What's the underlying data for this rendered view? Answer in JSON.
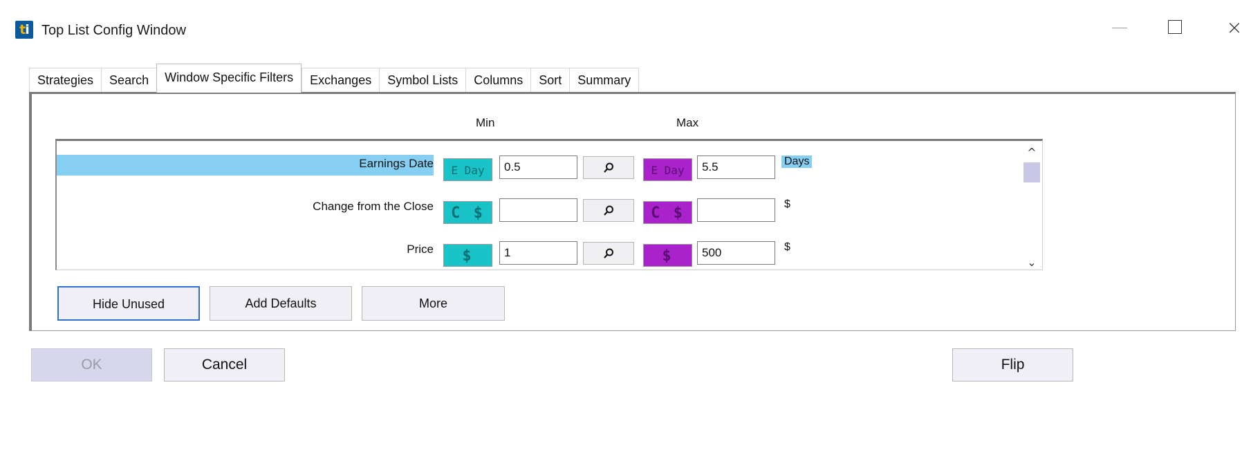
{
  "window": {
    "title": "Top List Config Window",
    "icon_letters": [
      "t",
      "i"
    ],
    "close_glyph": "×"
  },
  "tabs": [
    {
      "label": "Strategies",
      "active": false
    },
    {
      "label": "Search",
      "active": false
    },
    {
      "label": "Window Specific Filters",
      "active": true
    },
    {
      "label": "Exchanges",
      "active": false
    },
    {
      "label": "Symbol Lists",
      "active": false
    },
    {
      "label": "Columns",
      "active": false
    },
    {
      "label": "Sort",
      "active": false
    },
    {
      "label": "Summary",
      "active": false
    }
  ],
  "columns": {
    "min": "Min",
    "max": "Max"
  },
  "filters": [
    {
      "label": "Earnings Date",
      "min_badge": "E Day",
      "min_value": "0.5",
      "max_badge": "E Day",
      "max_value": "5.5",
      "unit": "Days",
      "selected": true
    },
    {
      "label": "Change from the Close",
      "min_badge": "C $",
      "min_value": "",
      "max_badge": "C $",
      "max_value": "",
      "unit": "$",
      "selected": false
    },
    {
      "label": "Price",
      "min_badge": "$",
      "min_value": "1",
      "max_badge": "$",
      "max_value": "500",
      "unit": "$",
      "selected": false
    }
  ],
  "scrollbar": {
    "up_glyph": "^",
    "down_glyph": "⌄"
  },
  "panel_buttons": {
    "hide_unused": "Hide Unused",
    "add_defaults": "Add Defaults",
    "more": "More"
  },
  "footer_buttons": {
    "ok": "OK",
    "cancel": "Cancel",
    "flip": "Flip"
  },
  "colors": {
    "min_badge": "#19c3c8",
    "max_badge": "#aa22cc",
    "selection": "#86cff3"
  }
}
